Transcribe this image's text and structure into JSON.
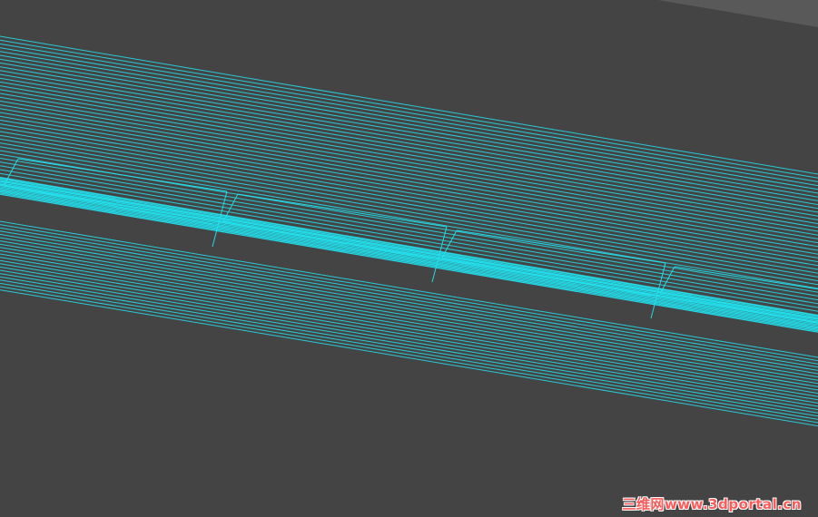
{
  "scene": {
    "view": "3D viewport (wireframe)",
    "background_color": "#444444",
    "wire_color": "#22e3f0",
    "edge_panel_color": "#595959"
  },
  "watermark": {
    "text": "三维网www.3dportal.cn",
    "color": "#ff5a5a"
  }
}
